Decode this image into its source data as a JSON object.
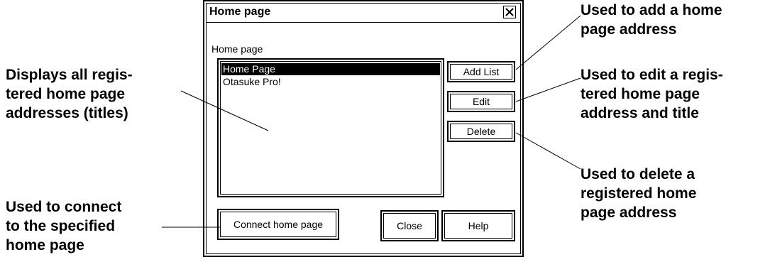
{
  "callouts": {
    "left_top": "Displays all regis-\ntered home page\naddresses (titles)",
    "left_bottom": "Used to connect\nto the specified\nhome page",
    "right_add": "Used to add a home\npage address",
    "right_edit": "Used to edit a regis-\ntered home page\naddress and title",
    "right_delete": "Used to delete a\nregistered home\npage address"
  },
  "dialog": {
    "title": "Home page",
    "group_label": "Home page",
    "list_items": [
      {
        "label": "Home Page",
        "selected": true
      },
      {
        "label": "Otasuke Pro!",
        "selected": false
      }
    ],
    "buttons": {
      "add_list": "Add List",
      "edit": "Edit",
      "delete": "Delete",
      "connect": "Connect home page",
      "close": "Close",
      "help": "Help"
    }
  }
}
